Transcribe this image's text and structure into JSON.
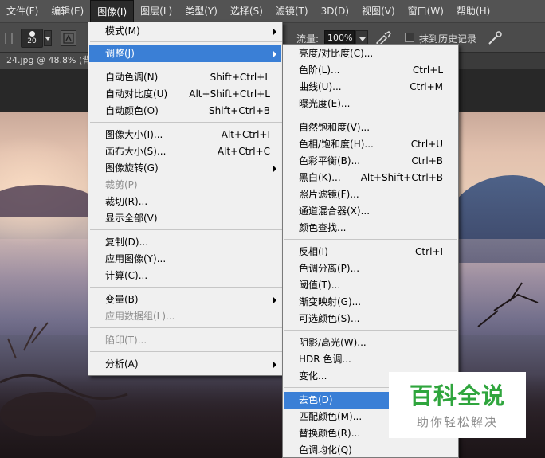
{
  "menubar": {
    "items": [
      {
        "label": "文件(F)"
      },
      {
        "label": "编辑(E)"
      },
      {
        "label": "图像(I)"
      },
      {
        "label": "图层(L)"
      },
      {
        "label": "类型(Y)"
      },
      {
        "label": "选择(S)"
      },
      {
        "label": "滤镜(T)"
      },
      {
        "label": "3D(D)"
      },
      {
        "label": "视图(V)"
      },
      {
        "label": "窗口(W)"
      },
      {
        "label": "帮助(H)"
      }
    ],
    "active_index": 2
  },
  "options_bar": {
    "brush_size": "20",
    "flow_label": "流量:",
    "flow_value": "100%",
    "erase_history_label": "抹到历史记录",
    "icons": [
      "brush-preset-icon",
      "brush-panel-icon",
      "airbrush-icon",
      "pressure-icon"
    ]
  },
  "document": {
    "tab_title": "24.jpg @ 48.8% (背"
  },
  "image_menu": {
    "items": [
      {
        "label": "模式(M)",
        "shortcut": "",
        "submenu": true,
        "disabled": false
      },
      {
        "label": "调整(J)",
        "shortcut": "",
        "submenu": true,
        "disabled": false,
        "highlight": true
      },
      {
        "label": "自动色调(N)",
        "shortcut": "Shift+Ctrl+L"
      },
      {
        "label": "自动对比度(U)",
        "shortcut": "Alt+Shift+Ctrl+L"
      },
      {
        "label": "自动颜色(O)",
        "shortcut": "Shift+Ctrl+B"
      },
      {
        "label": "图像大小(I)...",
        "shortcut": "Alt+Ctrl+I"
      },
      {
        "label": "画布大小(S)...",
        "shortcut": "Alt+Ctrl+C"
      },
      {
        "label": "图像旋转(G)",
        "shortcut": "",
        "submenu": true
      },
      {
        "label": "裁剪(P)",
        "shortcut": "",
        "disabled": true
      },
      {
        "label": "裁切(R)...",
        "shortcut": ""
      },
      {
        "label": "显示全部(V)",
        "shortcut": ""
      },
      {
        "label": "复制(D)...",
        "shortcut": ""
      },
      {
        "label": "应用图像(Y)...",
        "shortcut": ""
      },
      {
        "label": "计算(C)...",
        "shortcut": ""
      },
      {
        "label": "变量(B)",
        "shortcut": "",
        "submenu": true
      },
      {
        "label": "应用数据组(L)...",
        "shortcut": "",
        "disabled": true
      },
      {
        "label": "陷印(T)...",
        "shortcut": "",
        "disabled": true
      },
      {
        "label": "分析(A)",
        "shortcut": "",
        "submenu": true
      }
    ]
  },
  "adjust_menu": {
    "items": [
      {
        "label": "亮度/对比度(C)...",
        "shortcut": ""
      },
      {
        "label": "色阶(L)...",
        "shortcut": "Ctrl+L"
      },
      {
        "label": "曲线(U)...",
        "shortcut": "Ctrl+M"
      },
      {
        "label": "曝光度(E)...",
        "shortcut": ""
      },
      {
        "label": "自然饱和度(V)...",
        "shortcut": ""
      },
      {
        "label": "色相/饱和度(H)...",
        "shortcut": "Ctrl+U"
      },
      {
        "label": "色彩平衡(B)...",
        "shortcut": "Ctrl+B"
      },
      {
        "label": "黑白(K)...",
        "shortcut": "Alt+Shift+Ctrl+B"
      },
      {
        "label": "照片滤镜(F)...",
        "shortcut": ""
      },
      {
        "label": "通道混合器(X)...",
        "shortcut": ""
      },
      {
        "label": "颜色查找...",
        "shortcut": ""
      },
      {
        "label": "反相(I)",
        "shortcut": "Ctrl+I"
      },
      {
        "label": "色调分离(P)...",
        "shortcut": ""
      },
      {
        "label": "阈值(T)...",
        "shortcut": ""
      },
      {
        "label": "渐变映射(G)...",
        "shortcut": ""
      },
      {
        "label": "可选颜色(S)...",
        "shortcut": ""
      },
      {
        "label": "阴影/高光(W)...",
        "shortcut": ""
      },
      {
        "label": "HDR 色调...",
        "shortcut": ""
      },
      {
        "label": "变化...",
        "shortcut": ""
      },
      {
        "label": "去色(D)",
        "shortcut": "S",
        "highlight": true
      },
      {
        "label": "匹配颜色(M)...",
        "shortcut": ""
      },
      {
        "label": "替换颜色(R)...",
        "shortcut": ""
      },
      {
        "label": "色调均化(Q)",
        "shortcut": ""
      }
    ]
  },
  "watermark": {
    "title": "百科全说",
    "subtitle": "助你轻松解决"
  },
  "colors": {
    "menu_highlight": "#3a7fd6",
    "menubar_bg": "#535353",
    "menu_bg": "#f0f0f0",
    "watermark_green": "#2fa53d"
  }
}
